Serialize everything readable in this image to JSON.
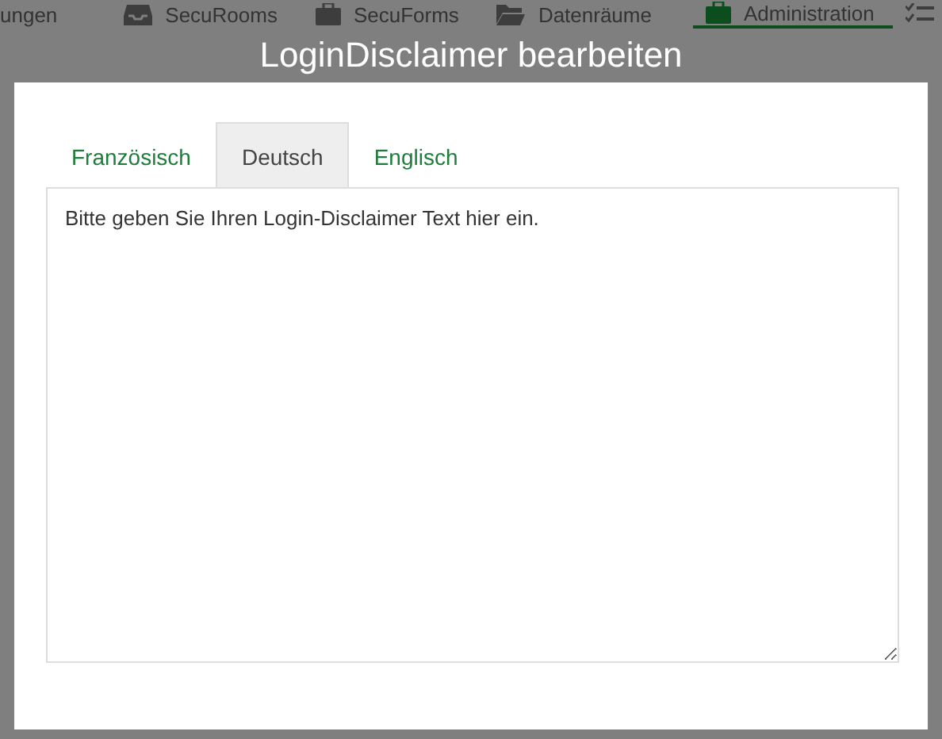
{
  "nav": {
    "items": [
      {
        "label": "ungen",
        "selected": false
      },
      {
        "label": "SecuRooms",
        "selected": false
      },
      {
        "label": "SecuForms",
        "selected": false
      },
      {
        "label": "Datenräume",
        "selected": false
      },
      {
        "label": "Administration",
        "selected": true
      }
    ]
  },
  "dialog": {
    "title": "LoginDisclaimer bearbeiten",
    "tabs": [
      {
        "label": "Französisch",
        "selected": false
      },
      {
        "label": "Deutsch",
        "selected": true
      },
      {
        "label": "Englisch",
        "selected": false
      }
    ],
    "text": "Bitte geben Sie Ihren Login-Disclaimer Text hier ein."
  }
}
